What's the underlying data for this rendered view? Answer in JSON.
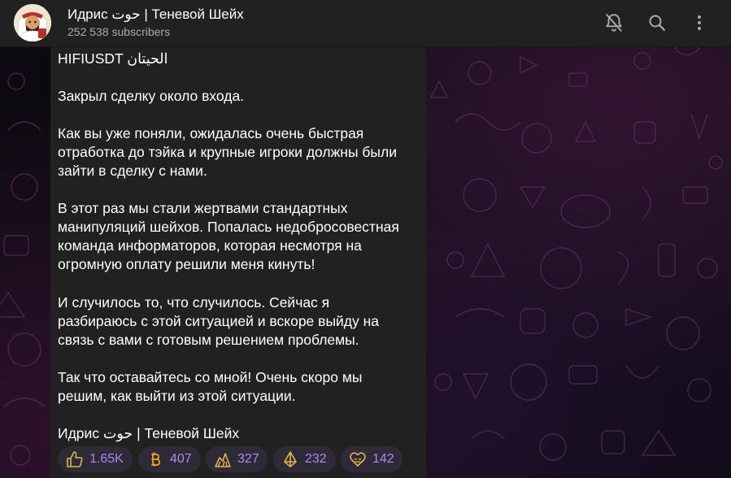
{
  "channel": {
    "title": "Идрис حوت | Теневой Шейх",
    "subscribers": "252 538 subscribers"
  },
  "header_icons": [
    "bell-muted-icon",
    "search-icon",
    "more-vertical-icon"
  ],
  "message": {
    "lines": [
      "HIFIUSDT الحيتان",
      "",
      "Закрыл сделку около входа.",
      "",
      "Как вы уже поняли, ожидалась очень быстрая",
      "отработка до тэйка и крупные игроки должны были",
      "зайти в сделку с нами.",
      "",
      "В этот раз мы стали жертвами стандартных",
      "манипуляций шейхов. Попалась недобросовестная",
      "команда информаторов, которая несмотря на",
      "огромную оплату решили меня кинуть!",
      "",
      "И случилось то, что случилось. Сейчас я",
      "разбираюсь с этой ситуацией и вскоре выйду на",
      "связь с вами с готовым решением проблемы.",
      "",
      "Так что оставайтесь со мной! Очень скоро мы",
      "решим, как выйти из этой ситуации.",
      "",
      "Идрис حوت | Теневой Шейх"
    ]
  },
  "reactions": [
    {
      "icon": "thumbs-up-icon",
      "count": "1.65K"
    },
    {
      "icon": "bitcoin-icon",
      "count": "407"
    },
    {
      "icon": "money-stack-icon",
      "count": "327"
    },
    {
      "icon": "diamond-icon",
      "count": "232"
    },
    {
      "icon": "heart-icon",
      "count": "142"
    }
  ],
  "colors": {
    "header_bg": "#212121",
    "bubble_bg": "#212121",
    "reaction_bg": "#2e2a37",
    "reaction_text": "#a889e8",
    "text_primary": "#ffffff",
    "text_secondary": "#aaaaaa"
  }
}
